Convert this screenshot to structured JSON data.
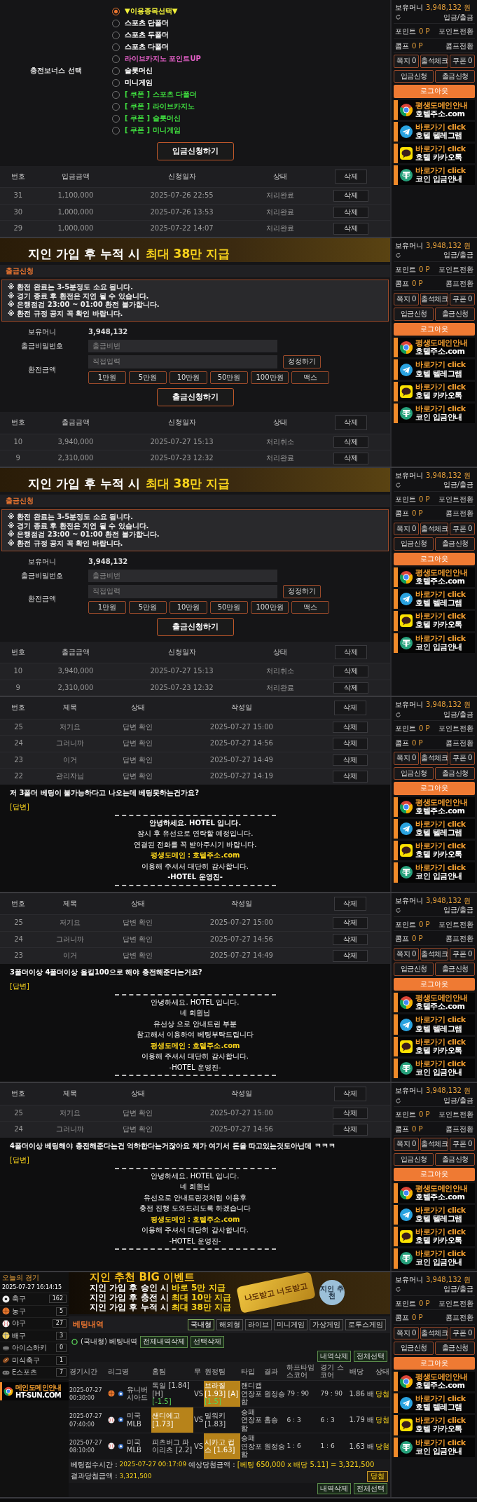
{
  "panels": [
    {
      "kind": "deposit",
      "bonus_label": "충전보너스 선택",
      "options": [
        {
          "label": "▼이용종목선택▼",
          "selected": true,
          "color": "#f2f23a"
        },
        {
          "label": "스포츠 단폴더",
          "selected": false,
          "color": "#ffffff"
        },
        {
          "label": "스포츠 두폴더",
          "selected": false,
          "color": "#ffffff"
        },
        {
          "label": "스포츠 다폴더",
          "selected": false,
          "color": "#ffffff"
        },
        {
          "label": "라이브카지노 포인트UP",
          "selected": false,
          "color": "#e45fc8"
        },
        {
          "label": "슬롯머신",
          "selected": false,
          "color": "#ffffff"
        },
        {
          "label": "미니게임",
          "selected": false,
          "color": "#ffffff"
        },
        {
          "label": "[ 쿠폰 ] 스포츠 다폴더",
          "selected": false,
          "color": "#3fdc3f"
        },
        {
          "label": "[ 쿠폰 ] 라이브카지노",
          "selected": false,
          "color": "#3fdc3f"
        },
        {
          "label": "[ 쿠폰 ] 슬롯머신",
          "selected": false,
          "color": "#3fdc3f"
        },
        {
          "label": "[ 쿠폰 ] 미니게임",
          "selected": false,
          "color": "#3fdc3f"
        }
      ],
      "submit": "입금신청하기",
      "table": {
        "columns": [
          "번호",
          "입금금액",
          "신청일자",
          "상태",
          "삭제"
        ],
        "rows": [
          [
            "31",
            "1,100,000",
            "2025-07-26 22:55",
            "처리완료",
            "삭제"
          ],
          [
            "30",
            "1,000,000",
            "2025-07-26 13:53",
            "처리완료",
            "삭제"
          ],
          [
            "29",
            "1,000,000",
            "2025-07-22 14:07",
            "처리완료",
            "삭제"
          ]
        ]
      },
      "sidebar": {
        "money_label": "보유머니",
        "money": "3,948,132 원",
        "money_link": "입금/출금",
        "point_label": "포인트",
        "point": "0 P",
        "point_link": "포인트전환",
        "comp_label": "콤프",
        "comp": "0 P",
        "comp_link": "콤프전환",
        "top_buttons": [
          "쪽지 0",
          "출석체크",
          "쿠폰 0"
        ],
        "main_buttons": [
          "입금신청",
          "출금신청"
        ],
        "logout": "로그아웃",
        "banners": [
          {
            "kind": "chrome",
            "title": "평생도메인안내",
            "subtitle": "호텔주소.com"
          },
          {
            "kind": "telegram",
            "title": "바로가기 click",
            "subtitle": "호텔 텔레그램"
          },
          {
            "kind": "kakao",
            "title": "바로가기 click",
            "subtitle": "호텔 카카오톡"
          },
          {
            "kind": "tether",
            "title": "바로가기 click",
            "subtitle": "코인 입금안내"
          }
        ]
      }
    },
    {
      "kind": "withdraw",
      "banner": {
        "lead": "지인 가입 후 누적 시",
        "highlight": "최대 38만 지급"
      },
      "title": "출금신청",
      "notices": [
        "※ 환전 완료는 3-5분정도 소요 됩니다.",
        "※ 경기 종료 후 환전은 지연 될 수 있습니다.",
        "※ 은행점검 23:00 ~ 01:00 환전 불가합니다.",
        "※ 환전 규정 공지 꼭 확인 바랍니다."
      ],
      "balance_label": "보유머니",
      "balance": "3,948,132",
      "password_label": "출금비밀번호",
      "password_placeholder": "출금비번",
      "amount_label": "환전금액",
      "amount_placeholder": "직접입력",
      "reset": "정정하기",
      "amounts": [
        "1만원",
        "5만원",
        "10만원",
        "50만원",
        "100만원",
        "맥스"
      ],
      "submit": "출금신청하기",
      "table": {
        "columns": [
          "번호",
          "출금금액",
          "신청일자",
          "상태",
          "삭제"
        ],
        "rows": [
          [
            "10",
            "3,940,000",
            "2025-07-27 15:13",
            "처리취소",
            "삭제"
          ],
          [
            "9",
            "2,310,000",
            "2025-07-23 12:32",
            "처리완료",
            "삭제"
          ]
        ]
      },
      "sidebar": {
        "money_label": "보유머니",
        "money": "3,948,132 원",
        "money_link": "입금/출금",
        "point_label": "포인트",
        "point": "0 P",
        "point_link": "포인트전환",
        "comp_label": "콤프",
        "comp": "0 P",
        "comp_link": "콤프전환",
        "top_buttons": [
          "쪽지 0",
          "출석체크",
          "쿠폰 0"
        ],
        "main_buttons": [
          "입금신청",
          "출금신청"
        ],
        "logout": "로그아웃",
        "banners": [
          {
            "kind": "chrome",
            "title": "평생도메인안내",
            "subtitle": "호텔주소.com"
          },
          {
            "kind": "telegram",
            "title": "바로가기 click",
            "subtitle": "호텔 텔레그램"
          },
          {
            "kind": "kakao",
            "title": "바로가기 click",
            "subtitle": "호텔 카카오톡"
          },
          {
            "kind": "tether",
            "title": "바로가기 click",
            "subtitle": "코인 입금안내"
          }
        ]
      }
    },
    {
      "kind": "withdraw",
      "banner": {
        "lead": "지인 가입 후 누적 시",
        "highlight": "최대 38만 지급"
      },
      "title": "출금신청",
      "notices": [
        "※ 환전 완료는 3-5분정도 소요 됩니다.",
        "※ 경기 종료 후 환전은 지연 될 수 있습니다.",
        "※ 은행점검 23:00 ~ 01:00 환전 불가합니다.",
        "※ 환전 규정 공지 꼭 확인 바랍니다."
      ],
      "balance_label": "보유머니",
      "balance": "3,948,132",
      "password_label": "출금비밀번호",
      "password_placeholder": "출금비번",
      "amount_label": "환전금액",
      "amount_placeholder": "직접입력",
      "reset": "정정하기",
      "amounts": [
        "1만원",
        "5만원",
        "10만원",
        "50만원",
        "100만원",
        "맥스"
      ],
      "submit": "출금신청하기",
      "table": {
        "columns": [
          "번호",
          "출금금액",
          "신청일자",
          "상태",
          "삭제"
        ],
        "rows": [
          [
            "10",
            "3,940,000",
            "2025-07-27 15:13",
            "처리취소",
            "삭제"
          ],
          [
            "9",
            "2,310,000",
            "2025-07-23 12:32",
            "처리완료",
            "삭제"
          ]
        ]
      },
      "sidebar": {
        "money_label": "보유머니",
        "money": "3,948,132 원",
        "money_link": "입금/출금",
        "point_label": "포인트",
        "point": "0 P",
        "point_link": "포인트전환",
        "comp_label": "콤프",
        "comp": "0 P",
        "comp_link": "콤프전환",
        "top_buttons": [
          "쪽지 0",
          "출석체크",
          "쿠폰 0"
        ],
        "main_buttons": [
          "입금신청",
          "출금신청"
        ],
        "logout": "로그아웃",
        "banners": [
          {
            "kind": "chrome",
            "title": "평생도메인안내",
            "subtitle": "호텔주소.com"
          },
          {
            "kind": "telegram",
            "title": "바로가기 click",
            "subtitle": "호텔 텔레그램"
          },
          {
            "kind": "kakao",
            "title": "바로가기 click",
            "subtitle": "호텔 카카오톡"
          },
          {
            "kind": "tether",
            "title": "바로가기 click",
            "subtitle": "코인 입금안내"
          }
        ]
      }
    },
    {
      "kind": "board",
      "table": {
        "columns": [
          "번호",
          "제목",
          "상태",
          "작성일",
          "삭제"
        ],
        "rows": [
          [
            "25",
            "저기요",
            "답변 확인",
            "2025-07-27 15:00",
            "삭제"
          ],
          [
            "24",
            "그러니까",
            "답변 확인",
            "2025-07-27 14:56",
            "삭제"
          ],
          [
            "23",
            "이거",
            "답변 확인",
            "2025-07-27 14:49",
            "삭제"
          ],
          [
            "22",
            "관리자님",
            "답변 확인",
            "2025-07-27 14:19",
            "삭제"
          ]
        ]
      },
      "question": "저 3폴더 베팅이 불가능하다고 나오는데 베팅못하는건가요?",
      "answer_tag": "[답변]",
      "answer_lines": [
        {
          "kind": "bold",
          "text": "안녕하세요. HOTEL 입니다."
        },
        {
          "kind": "plain",
          "text": "잠시 후 유선으로 연락할 예정입니다."
        },
        {
          "kind": "plain",
          "text": "연결된 전화를 꼭 받아주시기 바랍니다."
        },
        {
          "kind": "domain",
          "text": "평생도메인 : 호텔주소.com"
        },
        {
          "kind": "plain",
          "text": "이용해 주셔서 대단히 감사합니다."
        },
        {
          "kind": "bold",
          "text": "-HOTEL 운영진-"
        }
      ],
      "sidebar": {
        "money_label": "보유머니",
        "money": "3,948,132 원",
        "money_link": "입금/출금",
        "point_label": "포인트",
        "point": "0 P",
        "point_link": "포인트전환",
        "comp_label": "콤프",
        "comp": "0 P",
        "comp_link": "콤프전환",
        "top_buttons": [
          "쪽지 0",
          "출석체크",
          "쿠폰 0"
        ],
        "main_buttons": [
          "입금신청",
          "출금신청"
        ],
        "logout": "로그아웃",
        "banners": [
          {
            "kind": "chrome",
            "title": "평생도메인안내",
            "subtitle": "호텔주소.com"
          },
          {
            "kind": "telegram",
            "title": "바로가기 click",
            "subtitle": "호텔 텔레그램"
          },
          {
            "kind": "kakao",
            "title": "바로가기 click",
            "subtitle": "호텔 카카오톡"
          },
          {
            "kind": "tether",
            "title": "바로가기 click",
            "subtitle": "코인 입금안내"
          }
        ]
      }
    },
    {
      "kind": "board",
      "table": {
        "columns": [
          "번호",
          "제목",
          "상태",
          "작성일",
          "삭제"
        ],
        "rows": [
          [
            "25",
            "저기요",
            "답변 확인",
            "2025-07-27 15:00",
            "삭제"
          ],
          [
            "24",
            "그러니까",
            "답변 확인",
            "2025-07-27 14:56",
            "삭제"
          ],
          [
            "23",
            "이거",
            "답변 확인",
            "2025-07-27 14:49",
            "삭제"
          ]
        ]
      },
      "question": "3폴더이상 4폴더이상 올킬100으로 해야 충전해준다는거죠?",
      "answer_tag": "[답변]",
      "answer_lines": [
        {
          "kind": "plain",
          "text": "안녕하세요. HOTEL 입니다."
        },
        {
          "kind": "plain",
          "text": "네 회원님"
        },
        {
          "kind": "plain",
          "text": "유선상 으로 안내드린 부분"
        },
        {
          "kind": "plain",
          "text": "참고해서 이용하여 베팅부탁드립니다"
        },
        {
          "kind": "domain",
          "text": "평생도메인 : 호텔주소.com"
        },
        {
          "kind": "plain",
          "text": "이용해 주셔서 대단히 감사합니다."
        },
        {
          "kind": "plain",
          "text": "-HOTEL 운영진-"
        }
      ],
      "sidebar": {
        "money_label": "보유머니",
        "money": "3,948,132 원",
        "money_link": "입금/출금",
        "point_label": "포인트",
        "point": "0 P",
        "point_link": "포인트전환",
        "comp_label": "콤프",
        "comp": "0 P",
        "comp_link": "콤프전환",
        "top_buttons": [
          "쪽지 0",
          "출석체크",
          "쿠폰 0"
        ],
        "main_buttons": [
          "입금신청",
          "출금신청"
        ],
        "logout": "로그아웃",
        "banners": [
          {
            "kind": "chrome",
            "title": "평생도메인안내",
            "subtitle": "호텔주소.com"
          },
          {
            "kind": "telegram",
            "title": "바로가기 click",
            "subtitle": "호텔 텔레그램"
          },
          {
            "kind": "kakao",
            "title": "바로가기 click",
            "subtitle": "호텔 카카오톡"
          },
          {
            "kind": "tether",
            "title": "바로가기 click",
            "subtitle": "코인 입금안내"
          }
        ]
      }
    },
    {
      "kind": "board",
      "table": {
        "columns": [
          "번호",
          "제목",
          "상태",
          "작성일",
          "삭제"
        ],
        "rows": [
          [
            "25",
            "저기요",
            "답변 확인",
            "2025-07-27 15:00",
            "삭제"
          ],
          [
            "24",
            "그러니까",
            "답변 확인",
            "2025-07-27 14:56",
            "삭제"
          ]
        ]
      },
      "question": "4폴더이상 베팅해야 충전해준다는건 억하한다는거잖아요 제가 여기서 돈을 따고있는것도아닌데 ㅋㅋㅋ",
      "answer_tag": "[답변]",
      "answer_lines": [
        {
          "kind": "plain",
          "text": "안녕하세요. HOTEL 입니다."
        },
        {
          "kind": "plain",
          "text": "네 회원님"
        },
        {
          "kind": "plain",
          "text": "유선으로 안내드린것처럼 이용후"
        },
        {
          "kind": "plain",
          "text": "충전 진행 도와드리도록 하겠습니다"
        },
        {
          "kind": "domain",
          "text": "평생도메인 : 호텔주소.com"
        },
        {
          "kind": "plain",
          "text": "이용해 주셔서 대단히 감사합니다."
        },
        {
          "kind": "plain",
          "text": "-HOTEL 운영진-"
        }
      ],
      "sidebar": {
        "money_label": "보유머니",
        "money": "3,948,132 원",
        "money_link": "입금/출금",
        "point_label": "포인트",
        "point": "0 P",
        "point_link": "포인트전환",
        "comp_label": "콤프",
        "comp": "0 P",
        "comp_link": "콤프전환",
        "top_buttons": [
          "쪽지 0",
          "출석체크",
          "쿠폰 0"
        ],
        "main_buttons": [
          "입금신청",
          "출금신청"
        ],
        "logout": "로그아웃",
        "banners": [
          {
            "kind": "chrome",
            "title": "평생도메인안내",
            "subtitle": "호텔주소.com"
          },
          {
            "kind": "telegram",
            "title": "바로가기 click",
            "subtitle": "호텔 텔레그램"
          },
          {
            "kind": "kakao",
            "title": "바로가기 click",
            "subtitle": "호텔 카카오톡"
          },
          {
            "kind": "tether",
            "title": "바로가기 click",
            "subtitle": "코인 입금안내"
          }
        ]
      }
    },
    {
      "kind": "site",
      "today_label": "오늘의 경기",
      "today_time": "2025-07-27 16:14:15",
      "sports": [
        {
          "kind": "soccer",
          "name": "축구",
          "count": "162"
        },
        {
          "kind": "basketball",
          "name": "농구",
          "count": "5"
        },
        {
          "kind": "baseball",
          "name": "야구",
          "count": "27"
        },
        {
          "kind": "volleyball",
          "name": "배구",
          "count": "3"
        },
        {
          "kind": "hockey",
          "name": "아이스하키",
          "count": "0"
        },
        {
          "kind": "football",
          "name": "미식축구",
          "count": "1"
        },
        {
          "kind": "esports",
          "name": "E스포츠",
          "count": "7"
        }
      ],
      "domain_banner": {
        "title": "메인도메인안내",
        "subtitle": "HT-SUN.COM"
      },
      "event": {
        "title": "지인 추천 BIG 이벤트",
        "lines": [
          {
            "lead": "지인 가입 후 승인 시",
            "highlight": "바로 5만 지급"
          },
          {
            "lead": "지인 가입 후 충전 시",
            "highlight": "최대 10만 지급"
          },
          {
            "lead": "지인 가입 후 누적 시",
            "highlight": "최대 38만 지급"
          }
        ],
        "badge": "지인 추천",
        "card": "나도받고 너도받고"
      },
      "history_title": "베팅내역",
      "tabs": [
        {
          "label": "국내형",
          "selected": true
        },
        {
          "label": "해외형",
          "selected": false
        },
        {
          "label": "라이브",
          "selected": false
        },
        {
          "label": "미니게임",
          "selected": false
        },
        {
          "label": "가상게임",
          "selected": false
        },
        {
          "label": "로투스게임",
          "selected": false
        }
      ],
      "sub_label": "(국내형) 베팅내역",
      "sub_buttons": [
        "전체내역삭제",
        "선택삭제"
      ],
      "actions": [
        "내역삭제",
        "전체선택"
      ],
      "columns": [
        "경기시간",
        "리그명",
        "홈팀",
        "무",
        "원정팀",
        "타입",
        "결과",
        "하프타임 스코어",
        "경기 스코어",
        "배당",
        "상태"
      ],
      "rows": [
        {
          "time": "2025-07-27 00:30:00",
          "kind": "basketball",
          "league": "유니버시아드",
          "home": {
            "team": "독일 [1.84] [H]",
            "note": "[-1.5]",
            "selected": false
          },
          "draw": "VS",
          "away": {
            "team": "브라질 [1.93] [A]",
            "note": "[1.5]",
            "selected": true
          },
          "type": "핸디캡 연장포함",
          "result": "원정승",
          "half": "79 : 90",
          "full": "79 : 90",
          "odds": "1.86 배",
          "status": "당첨"
        },
        {
          "time": "2025-07-27 07:40:00",
          "kind": "baseball",
          "league": "미국 MLB",
          "home": {
            "team": "샌디에고 [1.73]",
            "selected": true
          },
          "draw": "VS",
          "away": {
            "team": "밀워키 [1.83]",
            "selected": false
          },
          "type": "승패 연장포함",
          "result": "홈승",
          "half": "6 : 3",
          "full": "6 : 3",
          "odds": "1.79 배",
          "status": "당첨"
        },
        {
          "time": "2025-07-27 08:10:00",
          "kind": "baseball",
          "league": "미국 MLB",
          "home": {
            "team": "피츠버그 파이리츠 [2.2]",
            "selected": false
          },
          "draw": "VS",
          "away": {
            "team": "시카고 컵스 [1.63]",
            "selected": true
          },
          "type": "승패 연장포함",
          "result": "원정승",
          "half": "1 : 6",
          "full": "1 : 6",
          "odds": "1.63 배",
          "status": "당첨"
        }
      ],
      "footer": {
        "time_label": "베팅접수시간 :",
        "time": "2025-07-27 00:17:09",
        "expected_label": "예상당첨금액 :",
        "expected": "[베팅 650,000 x 배당 5.11] = 3,321,500",
        "result_label": "결과당첨금액 :",
        "result": "3,321,500",
        "status": "당첨"
      },
      "bottom_actions": [
        "내역삭제",
        "전체선택"
      ],
      "sidebar": {
        "money_label": "보유머니",
        "money": "3,948,132 원",
        "money_link": "입금/출금",
        "point_label": "포인트",
        "point": "0 P",
        "point_link": "포인트전환",
        "comp_label": "콤프",
        "comp": "0 P",
        "comp_link": "콤프전환",
        "top_buttons": [
          "쪽지 0",
          "출석체크",
          "쿠폰 0"
        ],
        "main_buttons": [
          "입금신청",
          "출금신청"
        ],
        "logout": "로그아웃",
        "banners": [
          {
            "kind": "chrome",
            "title": "평생도메인안내",
            "subtitle": "호텔주소.com"
          },
          {
            "kind": "telegram",
            "title": "바로가기 click",
            "subtitle": "호텔 텔레그램"
          },
          {
            "kind": "kakao",
            "title": "바로가기 click",
            "subtitle": "호텔 카카오톡"
          },
          {
            "kind": "tether",
            "title": "바로가기 click",
            "subtitle": "코인 입금안내"
          }
        ]
      }
    }
  ]
}
